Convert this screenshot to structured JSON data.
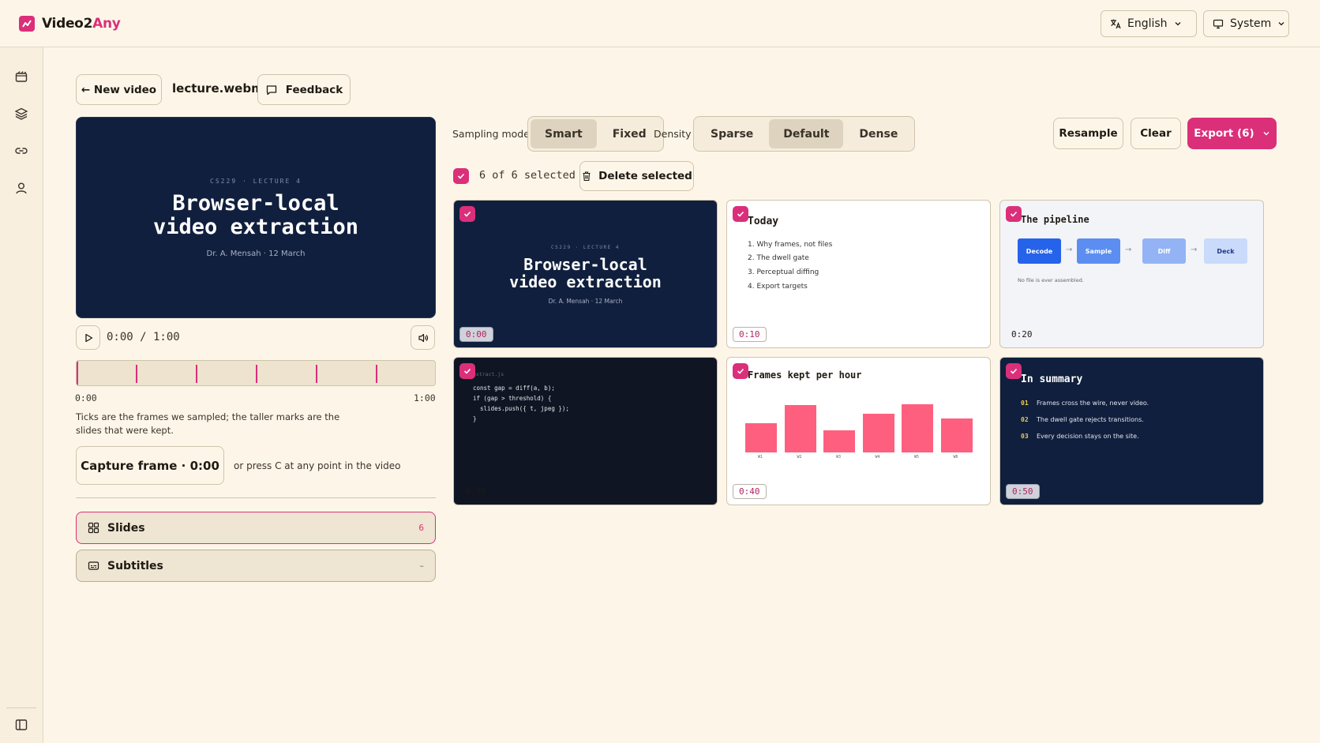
{
  "app": {
    "name_prefix": "Video2",
    "name_accent": "Any"
  },
  "header": {
    "language": "English",
    "theme": "System"
  },
  "colors": {
    "accent": "#db2f7a",
    "background": "#fdf6e8",
    "slide_dark": "#101f3d",
    "bar": "#ff5f7e"
  },
  "nav": {
    "rail_icons": [
      "video-icon",
      "layers-icon",
      "link-icon",
      "user-icon"
    ],
    "bottom_icon": "sidebar-toggle-icon",
    "new_video": "← New video",
    "filename": "lecture.webm",
    "feedback": "Feedback"
  },
  "player": {
    "slide": {
      "eyebrow": "CS229 · LECTURE 4",
      "title_line1": "Browser-local",
      "title_line2": "video extraction",
      "subtitle": "Dr. A. Mensah · 12 March"
    },
    "time": "0:00 / 1:00",
    "start": "0:00",
    "end": "1:00",
    "progress": 0,
    "hint": "Ticks are the frames we sampled; the taller marks are the slides that were kept.",
    "capture_label": "Capture frame · 0:00",
    "capture_note": "or press C at any point in the video",
    "slide_ticks_seconds": [
      10,
      20,
      30,
      40,
      50
    ]
  },
  "panels": [
    {
      "label": "Slides",
      "count": "6",
      "icon": "grid-icon"
    },
    {
      "label": "Subtitles",
      "count": "–",
      "icon": "captions-icon"
    }
  ],
  "toolbar": {
    "sampling_label": "Sampling mode",
    "sampling_options": [
      "Smart",
      "Fixed"
    ],
    "sampling_selected": "Smart",
    "density_label": "Density",
    "density_options": [
      "Sparse",
      "Default",
      "Dense"
    ],
    "density_selected": "Default",
    "resample": "Resample",
    "clear": "Clear",
    "export": "Export (6)"
  },
  "selection": {
    "text": "6 of 6 selected",
    "delete": "Delete selected"
  },
  "frames": [
    {
      "time": "0:00",
      "eyebrow": "CS229 · LECTURE 4",
      "title_line1": "Browser-local",
      "title_line2": "video extraction",
      "subtitle": "Dr. A. Mensah · 12 March"
    },
    {
      "time": "0:10",
      "heading": "Today",
      "items": [
        "1. Why frames, not files",
        "2. The dwell gate",
        "3. Perceptual diffing",
        "4. Export targets"
      ]
    },
    {
      "time": "0:20",
      "heading": "The pipeline",
      "steps": [
        "Decode",
        "Sample",
        "Diff",
        "Deck"
      ],
      "note": "No file is ever assembled."
    },
    {
      "time": "0:30",
      "filename": "extract.js",
      "code": [
        "const gap = diff(a, b);",
        "if (gap > threshold) {",
        "  slides.push({ t, jpeg });",
        "}"
      ]
    },
    {
      "time": "0:40",
      "heading": "Frames kept per hour",
      "chart_data": {
        "type": "bar",
        "categories": [
          "W1",
          "W2",
          "W3",
          "W4",
          "W5",
          "W6"
        ],
        "values": [
          43,
          70,
          33,
          58,
          71,
          50
        ],
        "ylim": [
          0,
          75
        ]
      }
    },
    {
      "time": "0:50",
      "heading": "In summary",
      "points": [
        {
          "num": "01",
          "text": "Frames cross the wire, never video."
        },
        {
          "num": "02",
          "text": "The dwell gate rejects transitions."
        },
        {
          "num": "03",
          "text": "Every decision stays on the site."
        }
      ]
    }
  ]
}
